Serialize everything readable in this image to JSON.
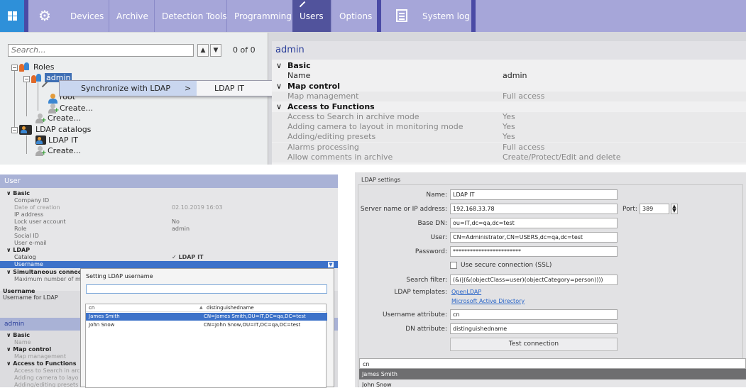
{
  "menu": {
    "items": [
      "Devices",
      "Archive",
      "Detection Tools",
      "Programming",
      "Users",
      "Options"
    ],
    "system_log": "System log"
  },
  "tree": {
    "search_placeholder": "Search...",
    "count": "0 of 0",
    "nodes": {
      "roles": "Roles",
      "admin": "admin",
      "root": "root",
      "create1": "Create...",
      "create2": "Create...",
      "ldap_catalogs": "LDAP catalogs",
      "ldap_it": "LDAP IT",
      "create3": "Create..."
    }
  },
  "context_menu": {
    "item": "Synchronize with LDAP",
    "arrow": ">",
    "submenu": "LDAP IT"
  },
  "role_panel": {
    "title": "admin",
    "sections": {
      "basic": "Basic",
      "map": "Map control",
      "functions": "Access to Functions"
    },
    "rows": {
      "name_k": "Name",
      "name_v": "admin",
      "map_k": "Map management",
      "map_v": "Full access",
      "f1_k": "Access to Search in archive mode",
      "f1_v": "Yes",
      "f2_k": "Adding camera to layout in monitoring mode",
      "f2_v": "Yes",
      "f3_k": "Adding/editing presets",
      "f3_v": "Yes",
      "f4_k": "Alarms processing",
      "f4_v": "Full access",
      "f5_k": "Allow comments in archive",
      "f5_v": "Create/Protect/Edit and delete"
    }
  },
  "user_panel": {
    "title": "User",
    "basic": "Basic",
    "company_id": "Company ID",
    "date_k": "Date of creation",
    "date_v": "02.10.2019 16:03",
    "ip": "IP address",
    "lock_k": "Lock user account",
    "lock_v": "No",
    "role_k": "Role",
    "role_v": "admin",
    "social": "Social ID",
    "email": "User e-mail",
    "ldap": "LDAP",
    "catalog_k": "Catalog",
    "catalog_v": "LDAP IT",
    "username": "Username",
    "simultaneous": "Simultaneous connec",
    "max_num": "Maximum number of mo",
    "desc_title": "Username",
    "desc_text": "Username for LDAP",
    "admin_title": "admin",
    "a_basic": "Basic",
    "a_name": "Name",
    "a_map": "Map control",
    "a_map_mgmt": "Map management",
    "a_func": "Access to Functions",
    "a_f1": "Access to Search in arch",
    "a_f2": "Adding camera to layo",
    "a_f3": "Adding/editing presets"
  },
  "dialog": {
    "title": "Setting LDAP username",
    "col_cn": "cn",
    "col_dn": "distinguishedname",
    "rows": [
      {
        "cn": "James Smith",
        "dn": "CN=James Smith,OU=IT,DC=qa,DC=test"
      },
      {
        "cn": "John Snow",
        "dn": "CN=John Snow,OU=IT,DC=qa,DC=test"
      }
    ]
  },
  "ldap_settings": {
    "header": "LDAP settings",
    "name_l": "Name:",
    "name_v": "LDAP IT",
    "server_l": "Server name or IP address:",
    "server_v": "192.168.33.78",
    "port_l": "Port:",
    "port_v": "389",
    "basedn_l": "Base DN:",
    "basedn_v": "ou=IT,dc=qa,dc=test",
    "user_l": "User:",
    "user_v": "CN=Administrator,CN=USERS,dc=qa,dc=test",
    "pass_l": "Password:",
    "pass_v": "************************",
    "ssl": "Use secure connection (SSL)",
    "filter_l": "Search filter:",
    "filter_v": "(&(|(&(objectClass=user)(objectCategory=person))))",
    "templates_l": "LDAP templates:",
    "tpl1": "OpenLDAP",
    "tpl2": "Microsoft Active Directory",
    "uattr_l": "Username attribute:",
    "uattr_v": "cn",
    "dnattr_l": "DN attribute:",
    "dnattr_v": "distinguishedname",
    "test_btn": "Test connection",
    "list_hdr": "cn",
    "list": [
      "James Smith",
      "John Snow"
    ]
  },
  "colors": {
    "menubar": "#a6a6d9",
    "selected_tab": "#51539c",
    "title_blue": "#2a3e9a",
    "selection": "#3d72c9"
  }
}
